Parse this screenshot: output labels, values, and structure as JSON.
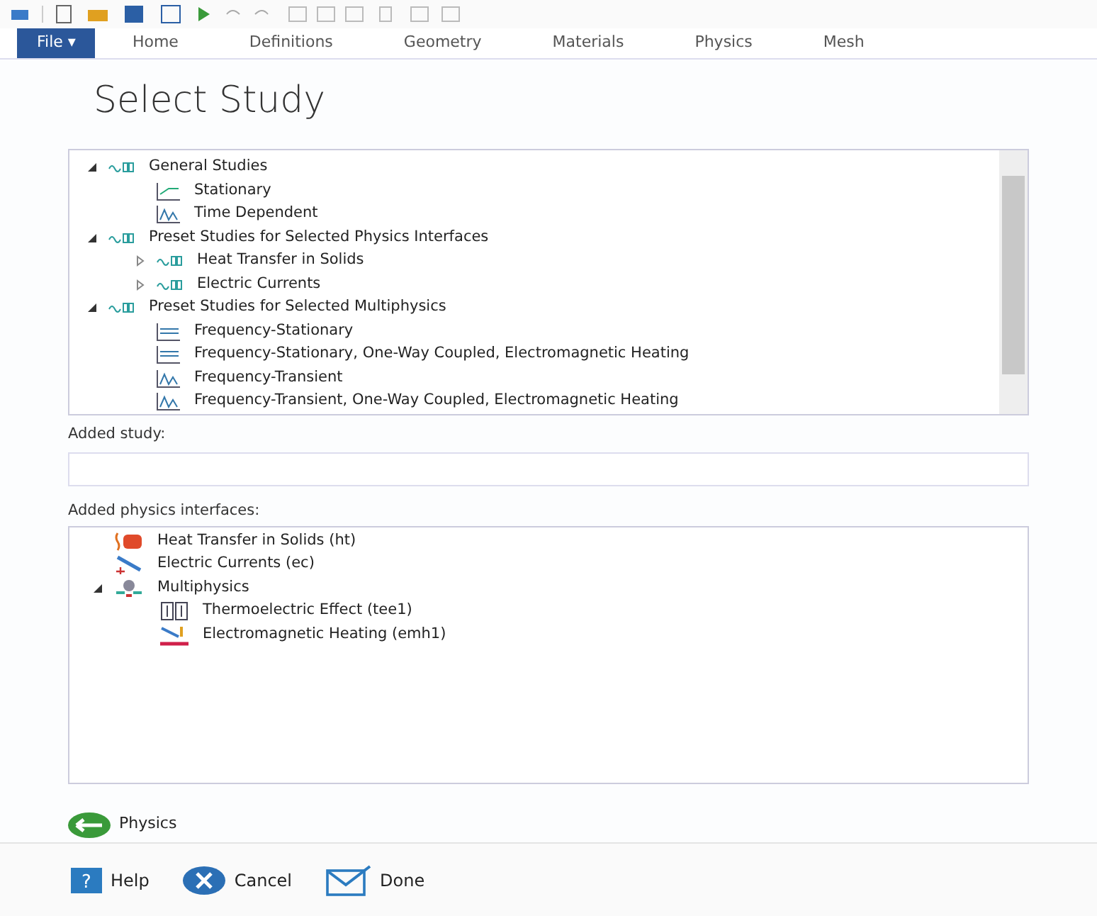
{
  "ribbon_tabs": [
    {
      "label": "File ▾",
      "selected": true
    },
    {
      "label": "Home",
      "selected": false
    },
    {
      "label": "Definitions",
      "selected": false
    },
    {
      "label": "Geometry",
      "selected": false
    },
    {
      "label": "Materials",
      "selected": false
    },
    {
      "label": "Physics",
      "selected": false
    },
    {
      "label": "Mesh",
      "selected": false
    }
  ],
  "title": "Select Study",
  "study_tree": [
    {
      "label": "General Studies",
      "kind": "group",
      "expanded": true,
      "children": [
        {
          "label": "Stationary",
          "kind": "stationary"
        },
        {
          "label": "Time Dependent",
          "kind": "transient"
        }
      ]
    },
    {
      "label": "Preset Studies for Selected Physics Interfaces",
      "kind": "group",
      "expanded": true,
      "children": [
        {
          "label": "Heat Transfer in Solids",
          "kind": "group",
          "expanded": false
        },
        {
          "label": "Electric Currents",
          "kind": "group",
          "expanded": false
        }
      ]
    },
    {
      "label": "Preset Studies for Selected Multiphysics",
      "kind": "group",
      "expanded": true,
      "children": [
        {
          "label": "Frequency-Stationary",
          "kind": "frequency"
        },
        {
          "label": "Frequency-Stationary, One-Way Coupled, Electromagnetic Heating",
          "kind": "frequency"
        },
        {
          "label": "Frequency-Transient",
          "kind": "transient"
        },
        {
          "label": "Frequency-Transient, One-Way Coupled, Electromagnetic Heating",
          "kind": "transient"
        }
      ]
    }
  ],
  "added_study": {
    "label": "Added study:"
  },
  "added_physics": {
    "label": "Added physics interfaces:",
    "items": [
      {
        "label": "Heat Transfer in Solids (ht)",
        "kind": "heat"
      },
      {
        "label": "Electric Currents (ec)",
        "kind": "electric"
      },
      {
        "label": "Multiphysics",
        "kind": "multiphysics",
        "expanded": true,
        "children": [
          {
            "label": "Thermoelectric Effect (tee1)",
            "kind": "thermoelectric"
          },
          {
            "label": "Electromagnetic Heating (emh1)",
            "kind": "emheating"
          }
        ]
      }
    ]
  },
  "back_button": {
    "label": "Physics"
  },
  "buttons": [
    {
      "label": "Help",
      "kind": "help",
      "icon_glyph": "?"
    },
    {
      "label": "Cancel",
      "kind": "cancel"
    },
    {
      "label": "Done",
      "kind": "done"
    }
  ]
}
